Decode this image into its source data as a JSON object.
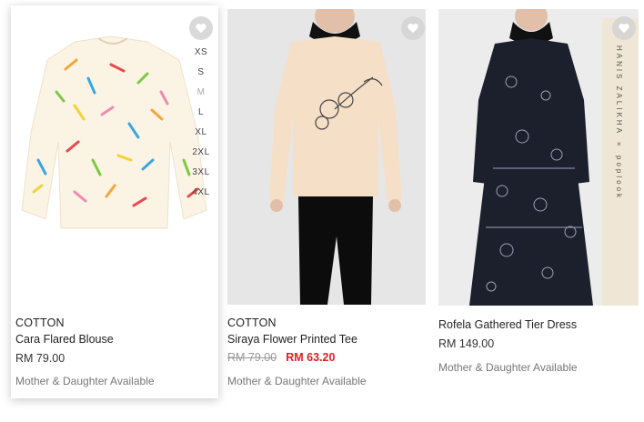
{
  "products": [
    {
      "category": "COTTON",
      "name": "Cara Flared Blouse",
      "price": "RM 79.00",
      "note": "Mother & Daughter Available",
      "sizes": [
        "XS",
        "S",
        "M",
        "L",
        "XL",
        "2XL",
        "3XL",
        "4XL"
      ],
      "unavailable_size": "M"
    },
    {
      "category": "COTTON",
      "name": "Siraya Flower Printed Tee",
      "old_price": "RM 79.00",
      "sale_price": "RM 63.20",
      "note": "Mother & Daughter Available"
    },
    {
      "category": "",
      "name": "Rofela Gathered Tier Dress",
      "price": "RM 149.00",
      "note": "Mother & Daughter Available",
      "banner_text": "HANIS ZALIKHA × poplook"
    }
  ],
  "icons": {
    "wishlist": "heart-icon"
  },
  "colors": {
    "sale": "#e02020",
    "muted": "#777777"
  }
}
